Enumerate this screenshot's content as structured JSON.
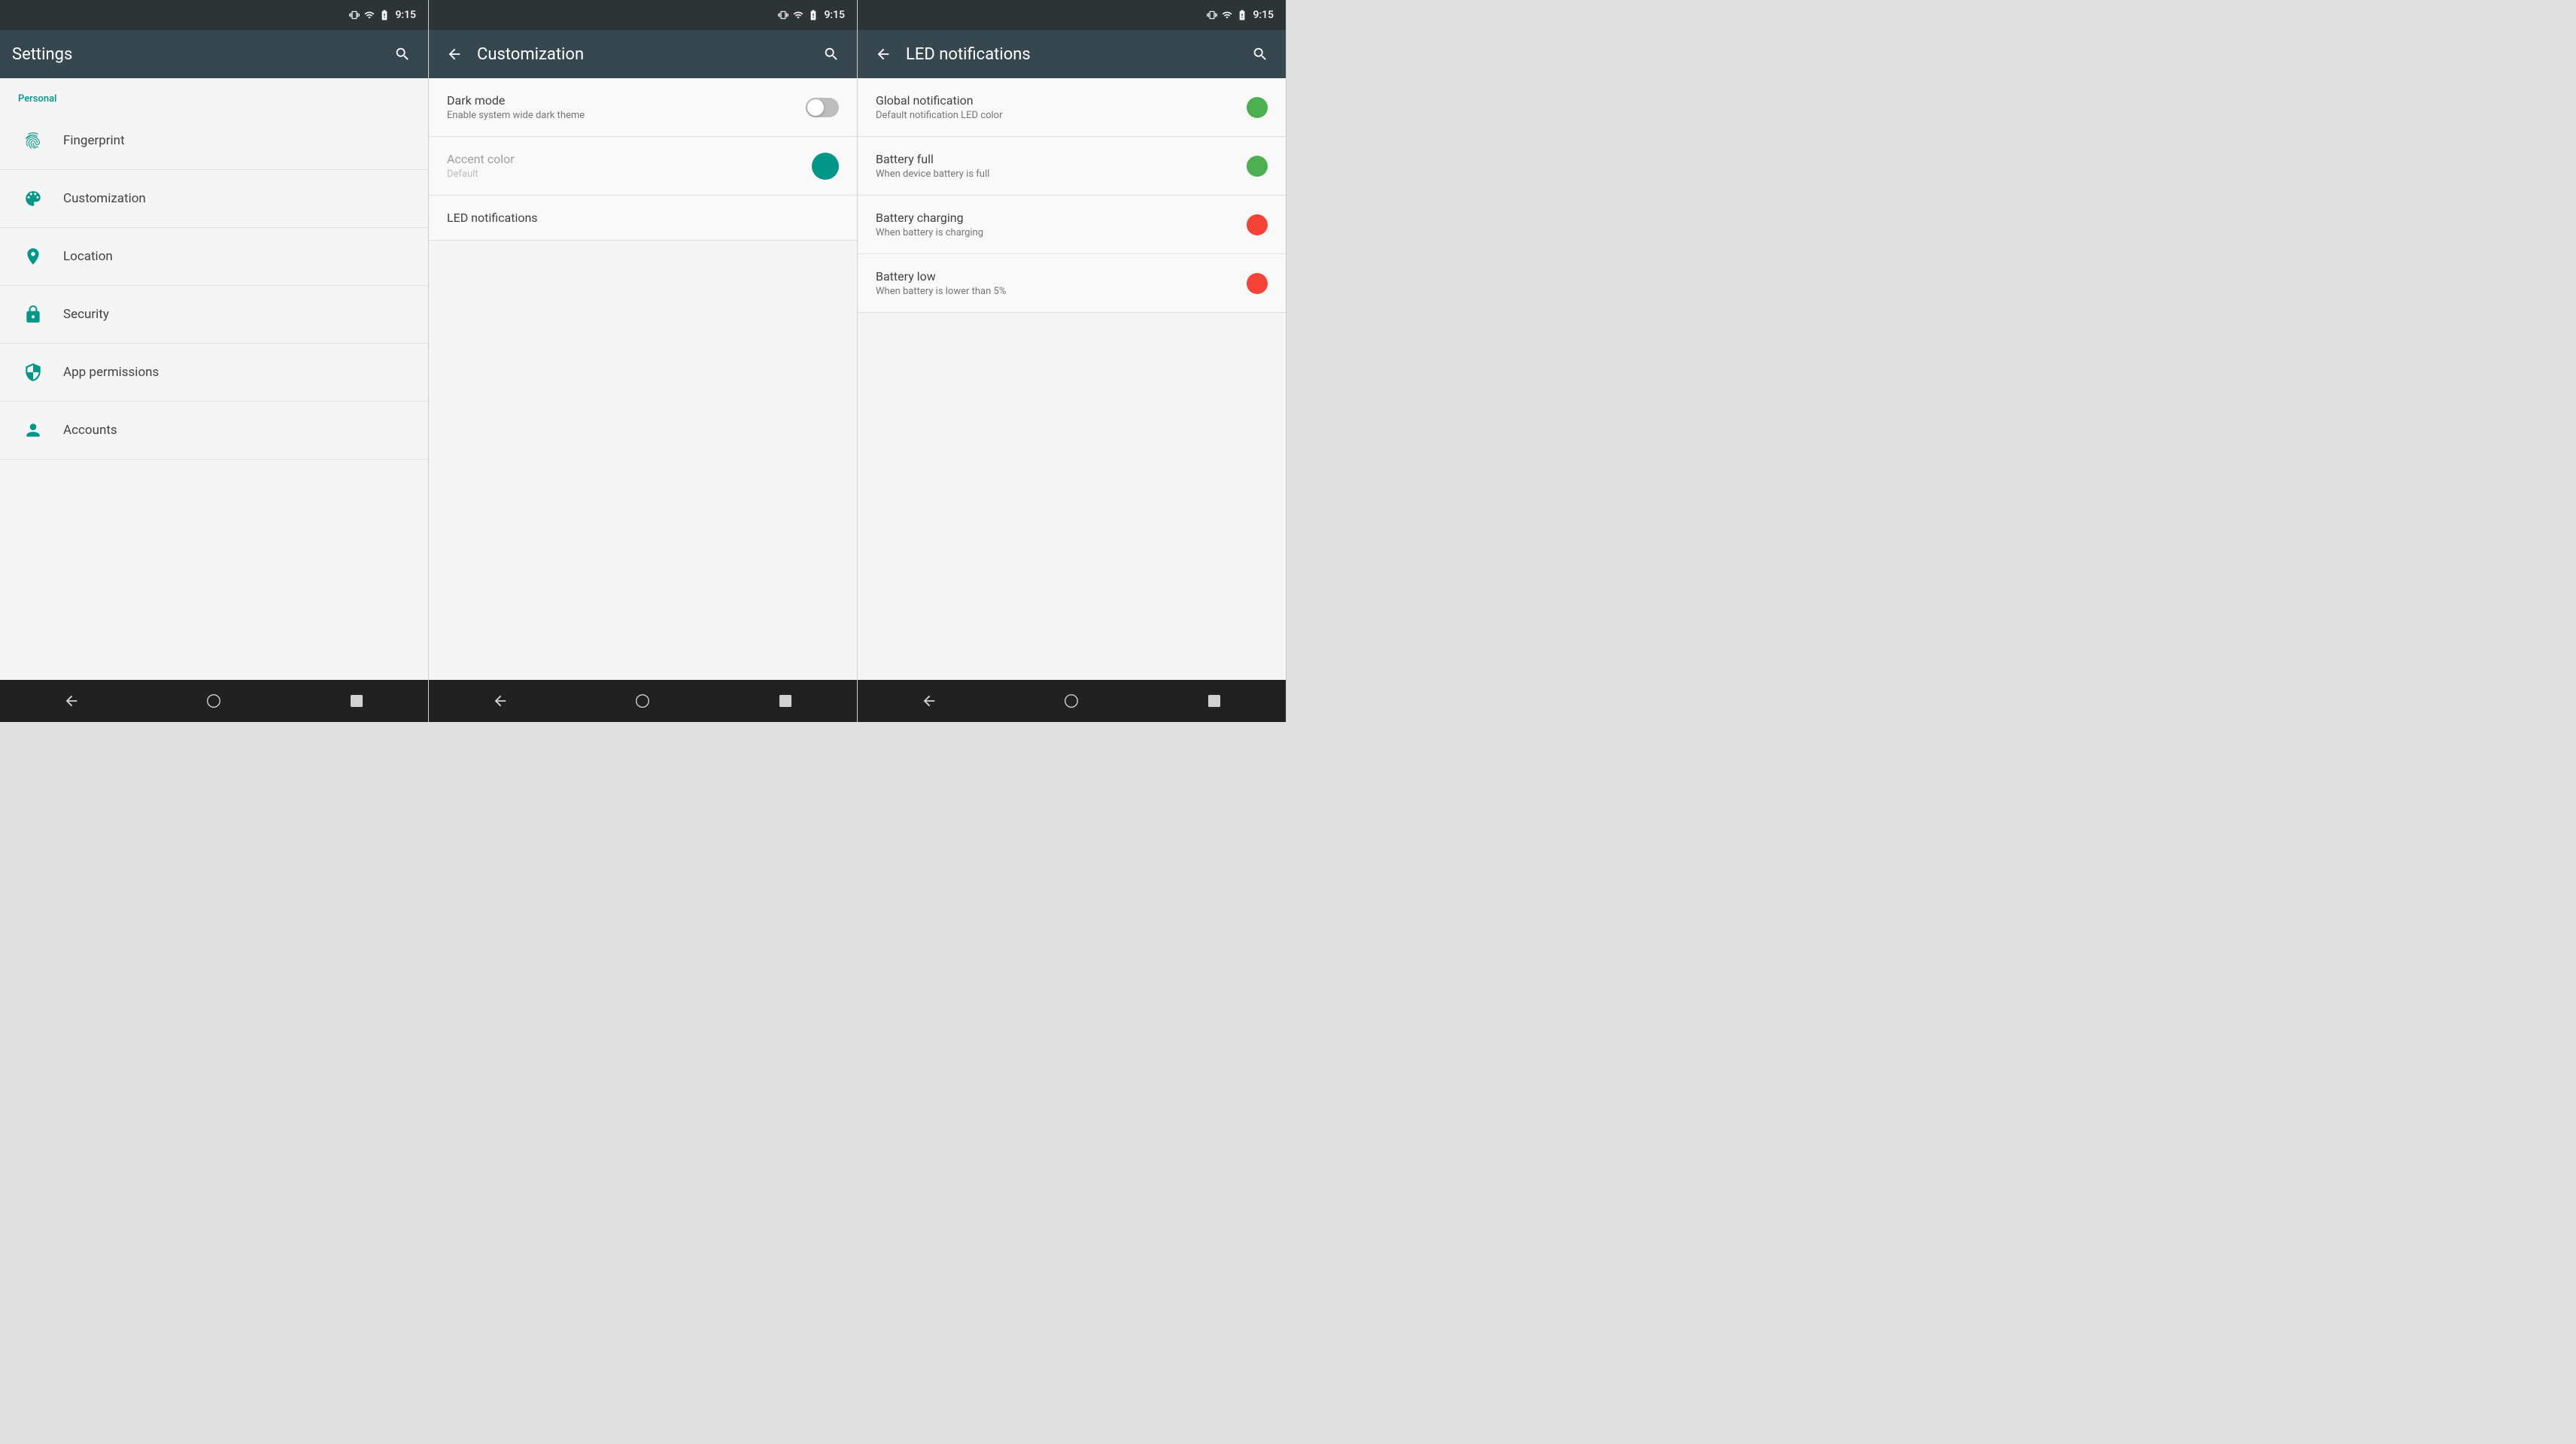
{
  "panel1": {
    "status_bar": {
      "time": "9:15"
    },
    "app_bar": {
      "title": "Settings",
      "search_label": "Search"
    },
    "section": {
      "label": "Personal"
    },
    "items": [
      {
        "id": "fingerprint",
        "label": "Fingerprint"
      },
      {
        "id": "customization",
        "label": "Customization"
      },
      {
        "id": "location",
        "label": "Location"
      },
      {
        "id": "security",
        "label": "Security"
      },
      {
        "id": "app-permissions",
        "label": "App permissions"
      },
      {
        "id": "accounts",
        "label": "Accounts"
      }
    ]
  },
  "panel2": {
    "status_bar": {
      "time": "9:15"
    },
    "app_bar": {
      "title": "Customization",
      "back_label": "Back",
      "search_label": "Search"
    },
    "items": [
      {
        "id": "dark-mode",
        "title": "Dark mode",
        "subtitle": "Enable system wide dark theme",
        "control": "toggle",
        "enabled": false,
        "disabled": false
      },
      {
        "id": "accent-color",
        "title": "Accent color",
        "subtitle": "Default",
        "control": "circle",
        "disabled": true
      },
      {
        "id": "led-notifications",
        "title": "LED notifications",
        "subtitle": "",
        "control": "none",
        "disabled": false
      }
    ]
  },
  "panel3": {
    "status_bar": {
      "time": "9:15"
    },
    "app_bar": {
      "title": "LED notifications",
      "back_label": "Back",
      "search_label": "Search"
    },
    "items": [
      {
        "id": "global-notification",
        "title": "Global notification",
        "subtitle": "Default notification LED color",
        "dot_color": "green"
      },
      {
        "id": "battery-full",
        "title": "Battery full",
        "subtitle": "When device battery is full",
        "dot_color": "green"
      },
      {
        "id": "battery-charging",
        "title": "Battery charging",
        "subtitle": "When battery is charging",
        "dot_color": "red"
      },
      {
        "id": "battery-low",
        "title": "Battery low",
        "subtitle": "When battery is lower than 5%",
        "dot_color": "red"
      }
    ]
  },
  "colors": {
    "teal": "#009688",
    "green": "#4caf50",
    "red": "#f44336"
  }
}
